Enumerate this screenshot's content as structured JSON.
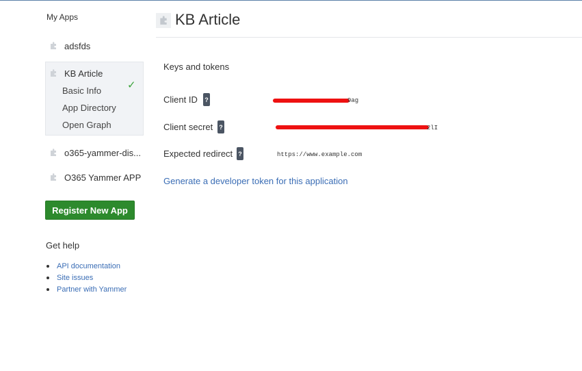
{
  "sidebar": {
    "title": "My Apps",
    "apps": [
      {
        "name": "adsfds"
      },
      {
        "name": "KB Article",
        "active": true,
        "sub_items": [
          "Basic Info",
          "App Directory",
          "Open Graph"
        ]
      },
      {
        "name": "o365-yammer-dis..."
      },
      {
        "name": "O365 Yammer APP"
      }
    ],
    "register_button": "Register New App",
    "help_title": "Get help",
    "help_links": [
      "API documentation",
      "Site issues",
      "Partner with Yammer"
    ]
  },
  "main": {
    "title": "KB Article",
    "section_title": "Keys and tokens",
    "fields": [
      {
        "label": "Client ID",
        "value_visible_suffix": "9ag"
      },
      {
        "label": "Client secret",
        "value_visible_suffix": "2lI"
      },
      {
        "label": "Expected redirect",
        "value": "https://www.example.com"
      }
    ],
    "help_icon_text": "?",
    "generate_link": "Generate a developer token for this application"
  },
  "colors": {
    "link": "#3a6db5",
    "register_button": "#2d8a2d",
    "check": "#3aa23a",
    "redaction": "#ee1111",
    "active_bg": "#f1f3f6"
  },
  "icons": {
    "app": "puzzle-icon",
    "active_subitem": "check-icon",
    "help": "question-mark-icon"
  }
}
